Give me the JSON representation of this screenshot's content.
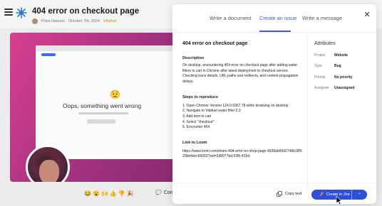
{
  "background": {
    "title": "404 error on checkout page",
    "author": "Priya Hanson",
    "date": "October 7th, 2024",
    "tag": "Vitafuel",
    "oops_text": "Oops, something went wrong",
    "comment_label": "Comme"
  },
  "modal": {
    "tabs": [
      "Write a document",
      "Create an issue",
      "Write a message"
    ],
    "active_tab": 1,
    "issue_title": "404 error on checkout page",
    "description_label": "Description",
    "description": "On desktop, encountering 404 error on checkout page after adding water filters to cart in Chrome after latest deployment to checkout service. Checking trace details, URL paths and redirects, and content propagation delays.",
    "steps_label": "Steps to reproduce",
    "steps": [
      "1. Open Chrome Version 124.0.6367.78 while browsing on desktop",
      "2. Navigate to Vitafuel water filter 2.3",
      "3. Add item to cart",
      "4. Select \"checkout\"",
      "5. Encounter 404"
    ],
    "loom_label": "Link to Loom",
    "loom_link": "https://www.loom.com/share-404-error-on-shop-page-4928ab06d2748b18f520bb4dcc66053?sid=2d8977bd-63f6-415d"
  },
  "attributes": {
    "title": "Attributes",
    "rows": [
      {
        "key": "Project",
        "value": "Website"
      },
      {
        "key": "Type",
        "value": "Bug"
      },
      {
        "key": "Priority",
        "value": "No priority"
      },
      {
        "key": "Assignee",
        "value": "Unassigned"
      }
    ]
  },
  "footer": {
    "copy_label": "Copy text",
    "jira_label": "Create in Jira"
  },
  "colors": {
    "accent": "#2f4fd9",
    "tab_active": "#3b5bdb"
  },
  "icons": [
    "menu-icon",
    "logo-icon",
    "close-icon",
    "copy-icon",
    "rocket-icon",
    "chevron-up-icon",
    "cursor-icon"
  ]
}
